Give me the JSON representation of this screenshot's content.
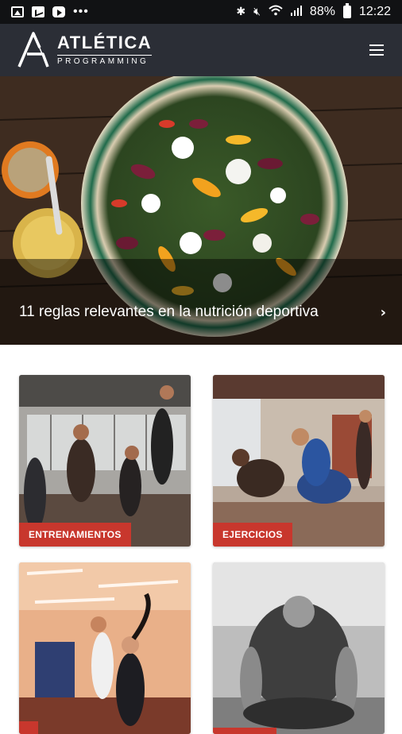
{
  "status_bar": {
    "icons": [
      "gallery-icon",
      "mail-icon",
      "youtube-icon",
      "more-dots-icon",
      "bluetooth-icon",
      "mute-icon",
      "wifi-icon",
      "signal-icon",
      "battery-icon"
    ],
    "dots": "•••",
    "battery": "88%",
    "time": "12:22"
  },
  "header": {
    "logo_title": "ATLÉTICA",
    "logo_subtitle": "PROGRAMMING"
  },
  "hero": {
    "caption": "11 reglas relevantes en la nutrición deportiva",
    "chevron": "›"
  },
  "categories": [
    {
      "label": "ENTRENAMIENTOS"
    },
    {
      "label": "EJERCICIOS"
    },
    {
      "label": ""
    },
    {
      "label": ""
    }
  ],
  "colors": {
    "status_bar": "#111214",
    "app_bar": "#2b2e36",
    "accent": "#c8372d"
  }
}
